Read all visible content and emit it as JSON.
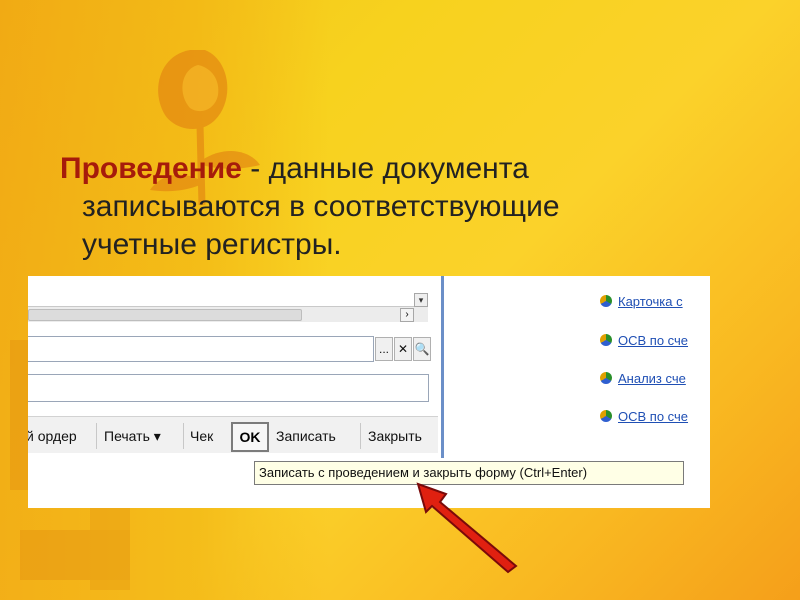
{
  "headline": {
    "term": "Проведение",
    "sep": " - ",
    "rest_line1": " данные документа",
    "rest_line2": "записываются в соответствующие",
    "rest_line3": "учетные регистры."
  },
  "form": {
    "toolbar": {
      "order_label": "й ордер",
      "print_label": "Печать",
      "print_arrow": "▾",
      "check_label": "Чек",
      "ok_label": "OK",
      "save_label": "Записать",
      "close_label": "Закрыть"
    },
    "field_buttons": {
      "choose": "...",
      "clear": "✕",
      "find": "🔍"
    },
    "scroll": {
      "down": "▾",
      "right": "›"
    },
    "tooltip": "Записать с проведением и закрыть форму (Ctrl+Enter)"
  },
  "reports": [
    {
      "label": "Карточка с",
      "icon": "globe-icon"
    },
    {
      "label": "ОСВ по сче",
      "icon": "globe-icon"
    },
    {
      "label": "Анализ сче",
      "icon": "globe-icon"
    },
    {
      "label": "ОСВ по сче",
      "icon": "globe-icon"
    }
  ],
  "colors": {
    "term": "#a61b0b",
    "arrow": "#e02010",
    "link": "#1f4fb4"
  }
}
